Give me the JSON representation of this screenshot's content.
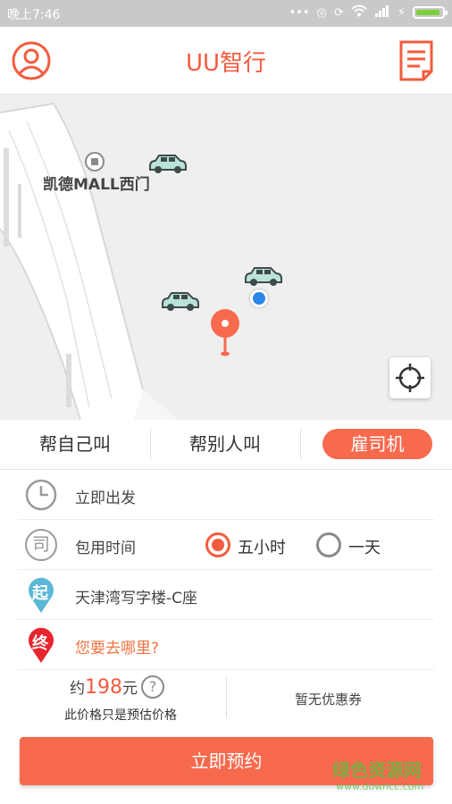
{
  "status_bar": {
    "time": "晚上7:46",
    "icons": [
      "more-icon",
      "alarm-icon",
      "sync-icon",
      "wifi-icon",
      "signal-icon",
      "charging-icon",
      "battery-icon"
    ],
    "battery_level": 0.95,
    "battery_color": "#7cd13a"
  },
  "header": {
    "title": "UU智行",
    "profile_icon": "user-icon",
    "orders_icon": "document-icon",
    "accent": "#f25c3f"
  },
  "map": {
    "poi_label": "凯德MALL西门",
    "poi_icon": "entrance-icon",
    "cars": 3,
    "locate_icon": "locate-icon"
  },
  "tabs": {
    "items": [
      {
        "label": "帮自己叫",
        "selected": false
      },
      {
        "label": "帮别人叫",
        "selected": false
      },
      {
        "label": "雇司机",
        "selected": true
      }
    ]
  },
  "form": {
    "depart": {
      "icon": "clock-icon",
      "text": "立即出发"
    },
    "charter": {
      "icon_char": "司",
      "label": "包用时间",
      "options": [
        {
          "label": "五小时",
          "selected": true
        },
        {
          "label": "一天",
          "selected": false
        }
      ]
    },
    "start": {
      "icon_char": "起",
      "text": "天津湾写字楼-C座",
      "color": "#5bb8d6"
    },
    "end": {
      "icon_char": "终",
      "text": "您要去哪里?",
      "color": "#e8242e"
    }
  },
  "price": {
    "prefix": "约",
    "amount": "198",
    "unit": "元",
    "help": "?",
    "note": "此价格只是预估价格",
    "coupon": "暂无优惠券"
  },
  "book_button": {
    "label": "立即预约",
    "color": "#f86a4e"
  },
  "watermark": {
    "text": "绿色资源网",
    "url": "www.downcc.com"
  }
}
